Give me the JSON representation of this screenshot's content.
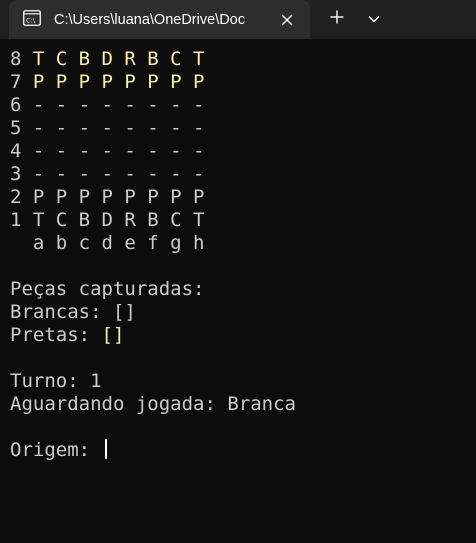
{
  "window": {
    "tab_title": "C:\\Users\\luana\\OneDrive\\Doc",
    "icons": {
      "tab": "terminal-icon",
      "close": "close-icon",
      "new_tab": "plus-icon",
      "dropdown": "chevron-down-icon"
    },
    "colors": {
      "titlebar": "#202020",
      "tab": "#2d2d2d",
      "background": "#0c0c0c",
      "text": "#cccccc",
      "black_pieces": "#f9f1a5"
    }
  },
  "board": {
    "rows": [
      {
        "rank": "8",
        "pieces": "T C B D R B C T"
      },
      {
        "rank": "7",
        "pieces": "P P P P P P P P"
      },
      {
        "rank": "6",
        "pieces": "- - - - - - - -"
      },
      {
        "rank": "5",
        "pieces": "- - - - - - - -"
      },
      {
        "rank": "4",
        "pieces": "- - - - - - - -"
      },
      {
        "rank": "3",
        "pieces": "- - - - - - - -"
      },
      {
        "rank": "2",
        "pieces": "P P P P P P P P"
      },
      {
        "rank": "1",
        "pieces": "T C B D R B C T"
      }
    ],
    "files": "a b c d e f g h"
  },
  "captured": {
    "heading": "Peças capturadas:",
    "white_label": "Brancas:",
    "white_list": "[]",
    "black_label": "Pretas:",
    "black_list": "[]"
  },
  "status": {
    "turn_label": "Turno:",
    "turn_value": "1",
    "waiting_label": "Aguardando jogada:",
    "waiting_value": "Branca"
  },
  "prompt": {
    "label": "Origem:",
    "value": ""
  }
}
